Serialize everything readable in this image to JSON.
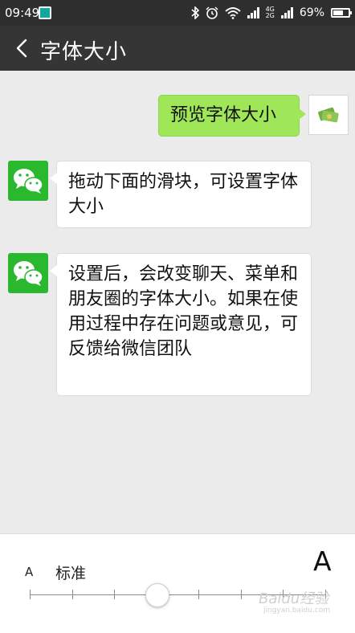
{
  "status_bar": {
    "time": "09:49",
    "battery": "69%",
    "battery_level": 0.69,
    "network_top": "4G",
    "network_bottom": "2G"
  },
  "header": {
    "title": "字体大小"
  },
  "messages": [
    {
      "sender": "user",
      "text": "预览字体大小"
    },
    {
      "sender": "wechat",
      "text": "拖动下面的滑块，可设置字体大小"
    },
    {
      "sender": "wechat",
      "text": "设置后，会改变聊天、菜单和朋友圈的字体大小。如果在使用过程中存在问题或意见，可反馈给微信团队"
    }
  ],
  "slider": {
    "small_label": "A",
    "current_label": "标准",
    "large_label": "A",
    "steps": 8,
    "selected_step": 3
  },
  "watermark": {
    "brand": "Baidu经验",
    "url": "jingyan.baidu.com"
  },
  "colors": {
    "header_bg": "#353535",
    "status_bg": "#2e2e2e",
    "chat_bg": "#ebebeb",
    "my_bubble": "#9fe658",
    "wechat_green": "#2ab92e"
  }
}
